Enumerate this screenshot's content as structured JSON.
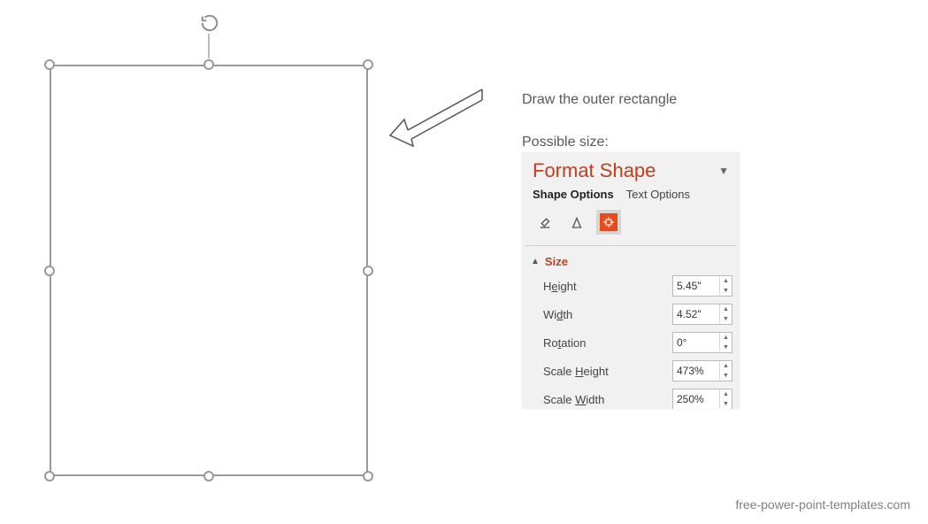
{
  "instruction1": "Draw the outer rectangle",
  "instruction2": "Possible size:",
  "panel": {
    "title": "Format Shape",
    "tab_shape": "Shape Options",
    "tab_text": "Text Options",
    "section_size": "Size",
    "props": {
      "height_label_pre": "H",
      "height_label_u": "e",
      "height_label_post": "ight",
      "height_val": "5.45\"",
      "width_label_pre": "Wi",
      "width_label_u": "d",
      "width_label_post": "th",
      "width_val": "4.52\"",
      "rotation_label_pre": "Ro",
      "rotation_label_u": "t",
      "rotation_label_post": "ation",
      "rotation_val": "0°",
      "sheight_label_pre": "Scale ",
      "sheight_label_u": "H",
      "sheight_label_post": "eight",
      "sheight_val": "473%",
      "swidth_label_pre": "Scale ",
      "swidth_label_u": "W",
      "swidth_label_post": "idth",
      "swidth_val": "250%"
    }
  },
  "footer": "free-power-point-templates.com"
}
